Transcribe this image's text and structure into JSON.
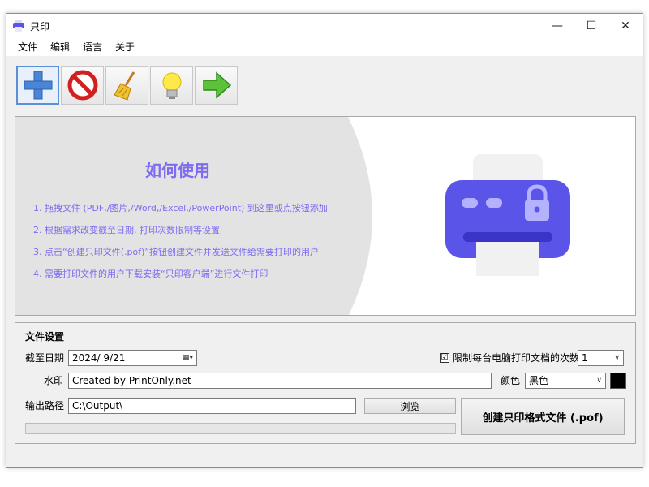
{
  "window": {
    "title": "只印"
  },
  "titlebar": {
    "minimize_glyph": "—",
    "maximize_glyph": "☐",
    "close_glyph": "✕"
  },
  "menu": [
    "文件",
    "编辑",
    "语言",
    "关于"
  ],
  "toolbar": {
    "buttons": [
      {
        "icon": "add-icon"
      },
      {
        "icon": "remove-icon"
      },
      {
        "icon": "broom-icon"
      },
      {
        "icon": "lightbulb-icon"
      },
      {
        "icon": "arrow-right-icon"
      }
    ]
  },
  "howto": {
    "title": "如何使用",
    "steps": [
      "1. 拖拽文件 (PDF,/图片,/Word,/Excel,/PowerPoint) 到这里或点按钮添加",
      "2. 根据需求改变截至日期, 打印次数限制等设置",
      "3. 点击“创建只印文件(.pof)”按钮创建文件并发送文件给需要打印的用户",
      "4. 需要打印文件的用户下载安装“只印客户端”进行文件打印"
    ],
    "accent_color": "#7b6cf0"
  },
  "settings": {
    "section_title": "文件设置",
    "deadline_label": "截至日期",
    "deadline_value": "2024/  9/21",
    "limit_checked_glyph": "☑",
    "limit_label": "限制每台电脑打印文档的次数",
    "limit_value": "1",
    "watermark_label": "水印",
    "watermark_value": "Created by PrintOnly.net",
    "color_label": "颜色",
    "color_value": "黑色",
    "color_swatch": "#000000",
    "output_label": "输出路径",
    "output_value": "C:\\Output\\",
    "browse_label": "浏览",
    "create_label": "创建只印格式文件 (.pof)",
    "progress": 0
  }
}
